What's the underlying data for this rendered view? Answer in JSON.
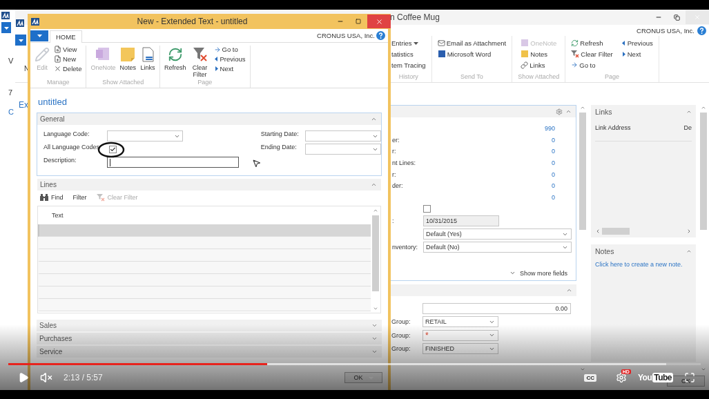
{
  "left_window": {
    "texts": [
      "V",
      "7",
      "C"
    ]
  },
  "item_window": {
    "title": "n Coffee Mug",
    "edge_texts": [
      "N",
      "Ex"
    ],
    "company": "CRONUS USA, Inc.",
    "ribbon_groups": [
      {
        "label": "History",
        "actions": [
          {
            "label": "Entries",
            "kind": "none",
            "dropdown": true,
            "disabled": false
          },
          {
            "label": "tatistics",
            "kind": "none",
            "dropdown": false,
            "disabled": false
          },
          {
            "label": "tem Tracing",
            "kind": "none",
            "dropdown": false,
            "disabled": false
          }
        ]
      },
      {
        "label": "Send To",
        "actions": [
          {
            "label": "Email as Attachment",
            "kind": "email",
            "dropdown": false,
            "disabled": false
          },
          {
            "label": "Microsoft Word",
            "kind": "word",
            "dropdown": false,
            "disabled": false
          }
        ]
      },
      {
        "label": "Show Attached",
        "actions": [
          {
            "label": "OneNote",
            "kind": "onenote",
            "dropdown": false,
            "disabled": true
          },
          {
            "label": "Notes",
            "kind": "notes",
            "dropdown": false,
            "disabled": false
          },
          {
            "label": "Links",
            "kind": "links",
            "dropdown": false,
            "disabled": false
          }
        ]
      },
      {
        "label": "Page",
        "actions": [
          {
            "label": "Refresh",
            "kind": "refresh",
            "dropdown": false,
            "disabled": false
          },
          {
            "label": "Clear Filter",
            "kind": "clear-filter",
            "dropdown": false,
            "disabled": false
          },
          {
            "label": "Go to",
            "kind": "goto",
            "dropdown": false,
            "disabled": false
          },
          {
            "label": "Previous",
            "kind": "previous",
            "dropdown": false,
            "disabled": false
          },
          {
            "label": "Next",
            "kind": "next",
            "dropdown": false,
            "disabled": false
          }
        ]
      }
    ],
    "panel": {
      "expanded": true,
      "fields": [
        {
          "kind": "number",
          "value": "990"
        },
        {
          "label": "er:",
          "kind": "number",
          "value": "0"
        },
        {
          "label": "r:",
          "kind": "number",
          "value": "0"
        },
        {
          "label": "nt Lines:",
          "kind": "number",
          "value": "0"
        },
        {
          "label": "r:",
          "kind": "number",
          "value": "0"
        },
        {
          "label": "der:",
          "kind": "number",
          "value": "0"
        },
        {
          "kind": "number",
          "value": "0"
        },
        {
          "kind": "checkbox",
          "checked": false
        },
        {
          "label": ":",
          "kind": "date",
          "value": "10/31/2015"
        },
        {
          "kind": "select-wide",
          "value": "Default (Yes)"
        },
        {
          "label": "nventory:",
          "kind": "select-wide",
          "value": "Default (No)"
        }
      ],
      "more": "Show more fields"
    },
    "panel2": {
      "expanded": true,
      "fields": [
        {
          "kind": "amount",
          "value": "0.00"
        },
        {
          "label": "Group:",
          "kind": "select",
          "value": "RETAIL"
        },
        {
          "label": "Group:",
          "kind": "required",
          "value": "*"
        },
        {
          "label": "Group:",
          "kind": "select",
          "value": "FINISHED"
        }
      ]
    },
    "links": {
      "title": "Links",
      "expanded": true,
      "columns": [
        "Link Address",
        "De"
      ]
    },
    "notes": {
      "title": "Notes",
      "expanded": true,
      "link": "Click here to create a new note."
    },
    "ok": "OK"
  },
  "dialog": {
    "title": "New - Extended Text - untitled",
    "tab": {
      "label": "HOME",
      "selected": true
    },
    "company": "CRONUS USA, Inc.",
    "ribbon_groups": [
      {
        "label": "Manage",
        "large": [
          {
            "label": "Edit",
            "kind": "edit",
            "disabled": true
          }
        ],
        "small": [
          {
            "label": "View",
            "kind": "view"
          },
          {
            "label": "New",
            "kind": "new"
          },
          {
            "label": "Delete",
            "kind": "delete"
          }
        ]
      },
      {
        "label": "Show Attached",
        "large": [
          {
            "label": "OneNote",
            "kind": "onenote",
            "disabled": true
          },
          {
            "label": "Notes",
            "kind": "notes",
            "disabled": false
          },
          {
            "label": "Links",
            "kind": "links",
            "disabled": false
          }
        ]
      },
      {
        "label": "Page",
        "large": [
          {
            "label": "Refresh",
            "kind": "refresh",
            "disabled": false
          },
          {
            "label": "Clear Filter",
            "kind": "clear-filter",
            "disabled": false
          }
        ],
        "small": [
          {
            "label": "Go to",
            "kind": "goto"
          },
          {
            "label": "Previous",
            "kind": "previous"
          },
          {
            "label": "Next",
            "kind": "next"
          }
        ]
      }
    ],
    "heading": "untitled",
    "general": {
      "title": "General",
      "expanded": true,
      "left": [
        {
          "label": "Language Code:",
          "kind": "select"
        },
        {
          "label": "All Language Codes",
          "kind": "checkbox",
          "checked": true
        },
        {
          "label": "Description:",
          "kind": "text",
          "focused": true
        }
      ],
      "right": [
        {
          "label": "Starting Date:",
          "kind": "select"
        },
        {
          "label": "Ending Date:",
          "kind": "select"
        }
      ]
    },
    "lines": {
      "title": "Lines",
      "expanded": true,
      "actions": [
        {
          "label": "Find",
          "kind": "find",
          "disabled": false
        },
        {
          "label": "Filter",
          "kind": "none",
          "disabled": false
        },
        {
          "label": "Clear Filter",
          "kind": "clear-filter",
          "disabled": true
        }
      ],
      "columns": [
        "Text"
      ],
      "rows": [
        {
          "selected": true
        },
        {
          "selected": false
        },
        {
          "selected": false
        },
        {
          "selected": false
        },
        {
          "selected": false
        },
        {
          "selected": false
        },
        {
          "selected": false
        }
      ]
    },
    "collapsed": [
      {
        "title": "Sales",
        "expanded": false
      },
      {
        "title": "Purchases",
        "expanded": false
      },
      {
        "title": "Service",
        "expanded": false
      }
    ],
    "ok": "OK"
  },
  "player": {
    "played": {
      "level": 0.374
    },
    "buffered": {
      "level": 0.95
    },
    "playing": false,
    "muted": true,
    "time": "2:13 / 5:57",
    "captions": "CC",
    "quality_badge": "HD",
    "logo": [
      "You",
      "Tube"
    ]
  }
}
